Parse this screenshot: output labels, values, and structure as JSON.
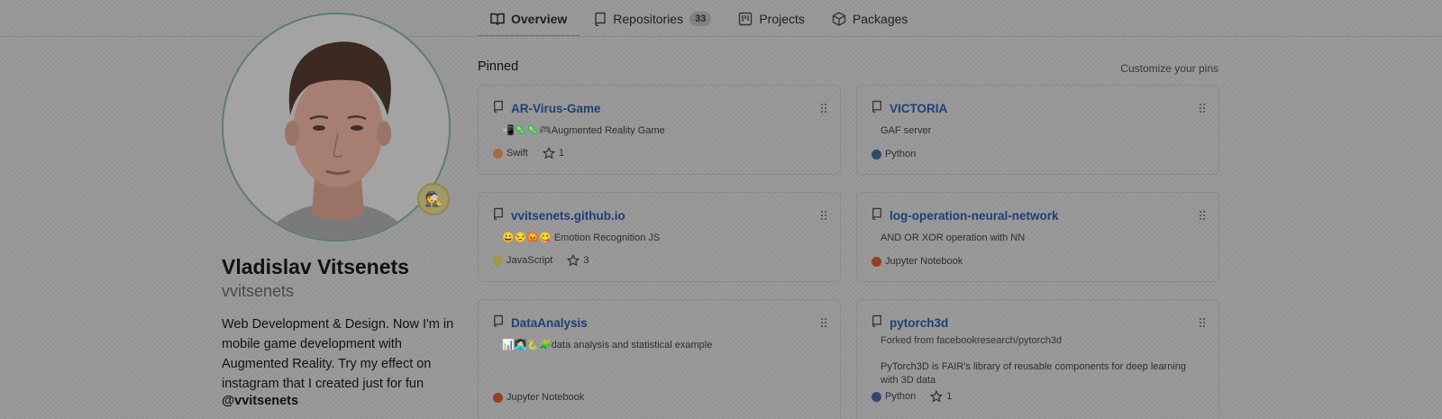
{
  "nav": {
    "tabs": [
      {
        "label": "Overview",
        "icon": "book-icon",
        "active": true
      },
      {
        "label": "Repositories",
        "icon": "repo-icon",
        "count": "33"
      },
      {
        "label": "Projects",
        "icon": "project-icon"
      },
      {
        "label": "Packages",
        "icon": "package-icon"
      }
    ]
  },
  "profile": {
    "fullname": "Vladislav Vitsenets",
    "username": "vvitsenets",
    "status_emoji": "🕵",
    "bio": "Web Development & Design. Now I'm in mobile game development with Augmented Reality. Try my effect on instagram that I created just for fun",
    "mention": "@vvitsenets"
  },
  "pinned": {
    "title": "Pinned",
    "customize": "Customize your pins",
    "cards": [
      {
        "name": "AR-Virus-Game",
        "desc": "📲🦠🦠🎮Augmented Reality Game",
        "lang": "Swift",
        "lang_color": "#a86b3d",
        "stars": "1"
      },
      {
        "name": "VICTORIA",
        "desc": "GAF server",
        "lang": "Python",
        "lang_color": "#2f4a6e",
        "stars": ""
      },
      {
        "name": "vvitsenets.github.io",
        "desc": "😀😒😡😋 Emotion Recognition JS",
        "lang": "JavaScript",
        "lang_color": "#a29748",
        "stars": "3"
      },
      {
        "name": "log-operation-neural-network",
        "desc": "AND OR XOR operation with NN",
        "lang": "Jupyter Notebook",
        "lang_color": "#943f1e",
        "stars": ""
      },
      {
        "name": "DataAnalysis",
        "desc": "📊👩🏻‍💻🐍🧩data analysis and statistical example",
        "lang": "Jupyter Notebook",
        "lang_color": "#943f1e",
        "stars": ""
      },
      {
        "name": "pytorch3d",
        "fork": "Forked from facebookresearch/pytorch3d",
        "desc": "PyTorch3D is FAIR's library of reusable components for deep learning with 3D data",
        "lang": "Python",
        "lang_color": "#2f4a6e",
        "stars": "1"
      }
    ]
  }
}
